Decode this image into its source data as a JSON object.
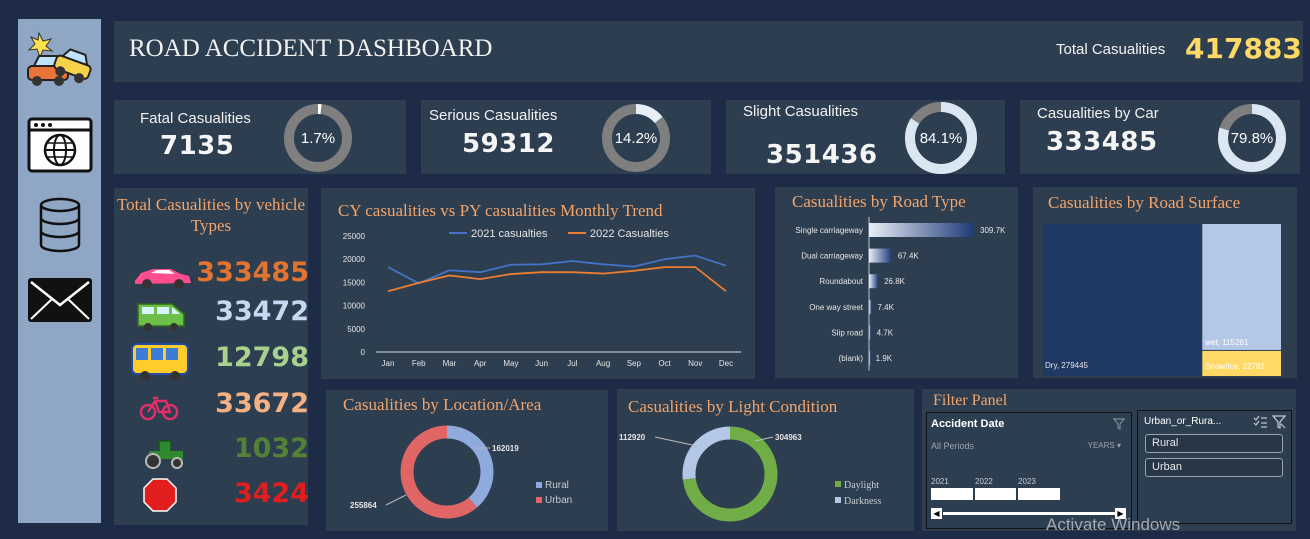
{
  "header": {
    "title": "ROAD ACCIDENT DASHBOARD",
    "total_label": "Total Casualities",
    "total_value": "417883"
  },
  "sidebar": {
    "items": [
      {
        "icon": "car-crash-icon"
      },
      {
        "icon": "web-browser-icon"
      },
      {
        "icon": "database-icon"
      },
      {
        "icon": "mail-icon"
      }
    ]
  },
  "kpis": [
    {
      "label": "Fatal Casualities",
      "value": "7135",
      "pct_text": "1.7%",
      "pct": 0.017,
      "ring_color": "#7f7f7f",
      "fill_color": "#ffffff"
    },
    {
      "label": "Serious Casualities",
      "value": "59312",
      "pct_text": "14.2%",
      "pct": 0.142,
      "ring_color": "#7f7f7f",
      "fill_color": "#e6eef8"
    },
    {
      "label": "Slight Casualities",
      "value": "351436",
      "pct_text": "84.1%",
      "pct": 0.841,
      "ring_color": "#7f7f7f",
      "fill_color": "#dbe6f3"
    },
    {
      "label": "Casualities by Car",
      "value": "333485",
      "pct_text": "79.8%",
      "pct": 0.798,
      "ring_color": "#7f7f7f",
      "fill_color": "#dbe6f3"
    }
  ],
  "vehicles": {
    "title": "Total Casualities by vehicle Types",
    "items": [
      {
        "icon": "car-icon",
        "value": "333485",
        "color": "#e2742f"
      },
      {
        "icon": "van-icon",
        "value": "33472",
        "color": "#c5d9f1"
      },
      {
        "icon": "bus-icon",
        "value": "12798",
        "color": "#a9d18e"
      },
      {
        "icon": "bicycle-icon",
        "value": "33672",
        "color": "#f4b183"
      },
      {
        "icon": "tractor-icon",
        "value": "1032",
        "color": "#548235"
      },
      {
        "icon": "stop-sign-icon",
        "value": "3424",
        "color": "#e01e1e"
      }
    ]
  },
  "trend": {
    "title": "CY casualities vs PY casualities Monthly Trend",
    "chart_data": {
      "type": "line",
      "x": [
        "Jan",
        "Feb",
        "Mar",
        "Apr",
        "May",
        "Jun",
        "Jul",
        "Aug",
        "Sep",
        "Oct",
        "Nov",
        "Dec"
      ],
      "series": [
        {
          "name": "2021 casualties",
          "color": "#4472c4",
          "values": [
            18300,
            14800,
            17600,
            17200,
            18800,
            18900,
            19600,
            18900,
            18400,
            20000,
            20800,
            18600
          ]
        },
        {
          "name": "2022 Casualties",
          "color": "#ed7d31",
          "values": [
            13100,
            14900,
            16500,
            15700,
            16800,
            17200,
            17200,
            16900,
            17500,
            18300,
            18300,
            13100
          ]
        }
      ],
      "yticks": [
        "0",
        "5000",
        "10000",
        "15000",
        "20000",
        "25000"
      ],
      "ylim": [
        0,
        25000
      ],
      "legend": "top"
    }
  },
  "road_type": {
    "title": "Casualities by Road Type",
    "chart_data": {
      "type": "bar",
      "categories": [
        "Single carriageway",
        "Dual carriageway",
        "Roundabout",
        "One way street",
        "Slip road",
        "(blank)"
      ],
      "values": [
        309.7,
        67.4,
        26.8,
        7.4,
        4.7,
        1.9
      ],
      "labels": [
        "309.7K",
        "67.4K",
        "26.8K",
        "7.4K",
        "4.7K",
        "1.9K"
      ],
      "xlim": [
        0,
        309.7
      ]
    }
  },
  "road_surface": {
    "title": "Casualities by Road Surface",
    "chart_data": {
      "type": "treemap",
      "items": [
        {
          "name": "Dry",
          "value": 279445,
          "label": "Dry, 279445",
          "color": "#1f3864"
        },
        {
          "name": "wet",
          "value": 115261,
          "label": "wet, 115261",
          "color": "#b4c7e7"
        },
        {
          "name": "Snow/Ice",
          "value": 22781,
          "label": "Snow/Ice, 22781",
          "color": "#ffd966"
        }
      ]
    }
  },
  "location": {
    "title": "Casualities by Location/Area",
    "chart_data": {
      "type": "pie",
      "slices": [
        {
          "name": "Rural",
          "value": 162019,
          "label": "162019",
          "color": "#8faadc"
        },
        {
          "name": "Urban",
          "value": 255864,
          "label": "255864",
          "color": "#e06666"
        }
      ]
    },
    "legend": [
      "Rural",
      "Urban"
    ]
  },
  "light": {
    "title": "Casualities by Light Condition",
    "chart_data": {
      "type": "pie",
      "slices": [
        {
          "name": "Daylight",
          "value": 304963,
          "label": "304963",
          "color": "#70ad47"
        },
        {
          "name": "Darkness",
          "value": 112920,
          "label": "112920",
          "color": "#b4c7e7"
        }
      ]
    },
    "legend": [
      "Daylight",
      "Darkness"
    ]
  },
  "filter": {
    "title": "Filter Panel",
    "date_slicer": {
      "title": "Accident Date",
      "period": "All Periods",
      "unit": "YEARS",
      "years": [
        "2021",
        "2022",
        "2023"
      ]
    },
    "area_slicer": {
      "title": "Urban_or_Rura...",
      "options": [
        "Rural",
        "Urban"
      ]
    }
  },
  "watermark": "Activate Windows"
}
